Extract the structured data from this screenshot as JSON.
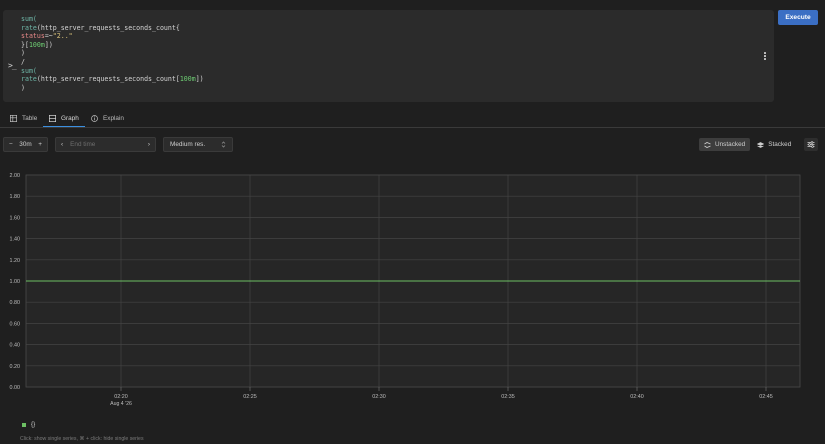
{
  "editor": {
    "lines": [
      [
        {
          "t": "sum(",
          "c": "fn"
        }
      ],
      [
        {
          "t": "rate",
          "c": "fn"
        },
        {
          "t": "(http_server_requests_seconds_count{",
          "c": ""
        }
      ],
      [
        {
          "t": "status",
          "c": "lbl"
        },
        {
          "t": "=~",
          "c": "op"
        },
        {
          "t": "\"2..\"",
          "c": "str"
        }
      ],
      [
        {
          "t": "}[",
          "c": ""
        },
        {
          "t": "100m",
          "c": "dur"
        },
        {
          "t": "])",
          "c": ""
        }
      ],
      [
        {
          "t": ")",
          "c": ""
        }
      ],
      [
        {
          "t": "/",
          "c": ""
        }
      ],
      [
        {
          "t": "sum(",
          "c": "fn"
        }
      ],
      [
        {
          "t": "rate",
          "c": "fn"
        },
        {
          "t": "(http_server_requests_seconds_count[",
          "c": ""
        },
        {
          "t": "100m",
          "c": "dur"
        },
        {
          "t": "])",
          "c": ""
        }
      ],
      [
        {
          "t": ")",
          "c": ""
        }
      ]
    ],
    "prompt_icon": ">_"
  },
  "execute_label": "Execute",
  "tabs": [
    {
      "label": "Table",
      "icon": "table-icon",
      "active": false
    },
    {
      "label": "Graph",
      "icon": "graph-icon",
      "active": true
    },
    {
      "label": "Explain",
      "icon": "info-icon",
      "active": false
    }
  ],
  "controls": {
    "range_minus": "−",
    "range_value": "30m",
    "range_plus": "+",
    "end_prev": "‹",
    "end_time_placeholder": "End time",
    "end_next": "›",
    "resolution": "Medium res.",
    "unstacked_label": "Unstacked",
    "stacked_label": "Stacked"
  },
  "chart_data": {
    "type": "line",
    "ylim": [
      0,
      2
    ],
    "yticks": [
      "0.00",
      "0.20",
      "0.40",
      "0.60",
      "0.80",
      "1.00",
      "1.20",
      "1.40",
      "1.60",
      "1.80",
      "2.00"
    ],
    "x": [
      "02:20",
      "02:25",
      "02:30",
      "02:35",
      "02:40",
      "02:45"
    ],
    "x_sublabel": "Aug 4 '26",
    "series": [
      {
        "name": "{}",
        "color": "#6cbf63",
        "values": [
          1,
          1,
          1,
          1,
          1,
          1
        ]
      }
    ],
    "grid": true
  },
  "legend": {
    "label": "{}"
  },
  "hint": "Click: show single series, ⌘ + click: hide single series"
}
